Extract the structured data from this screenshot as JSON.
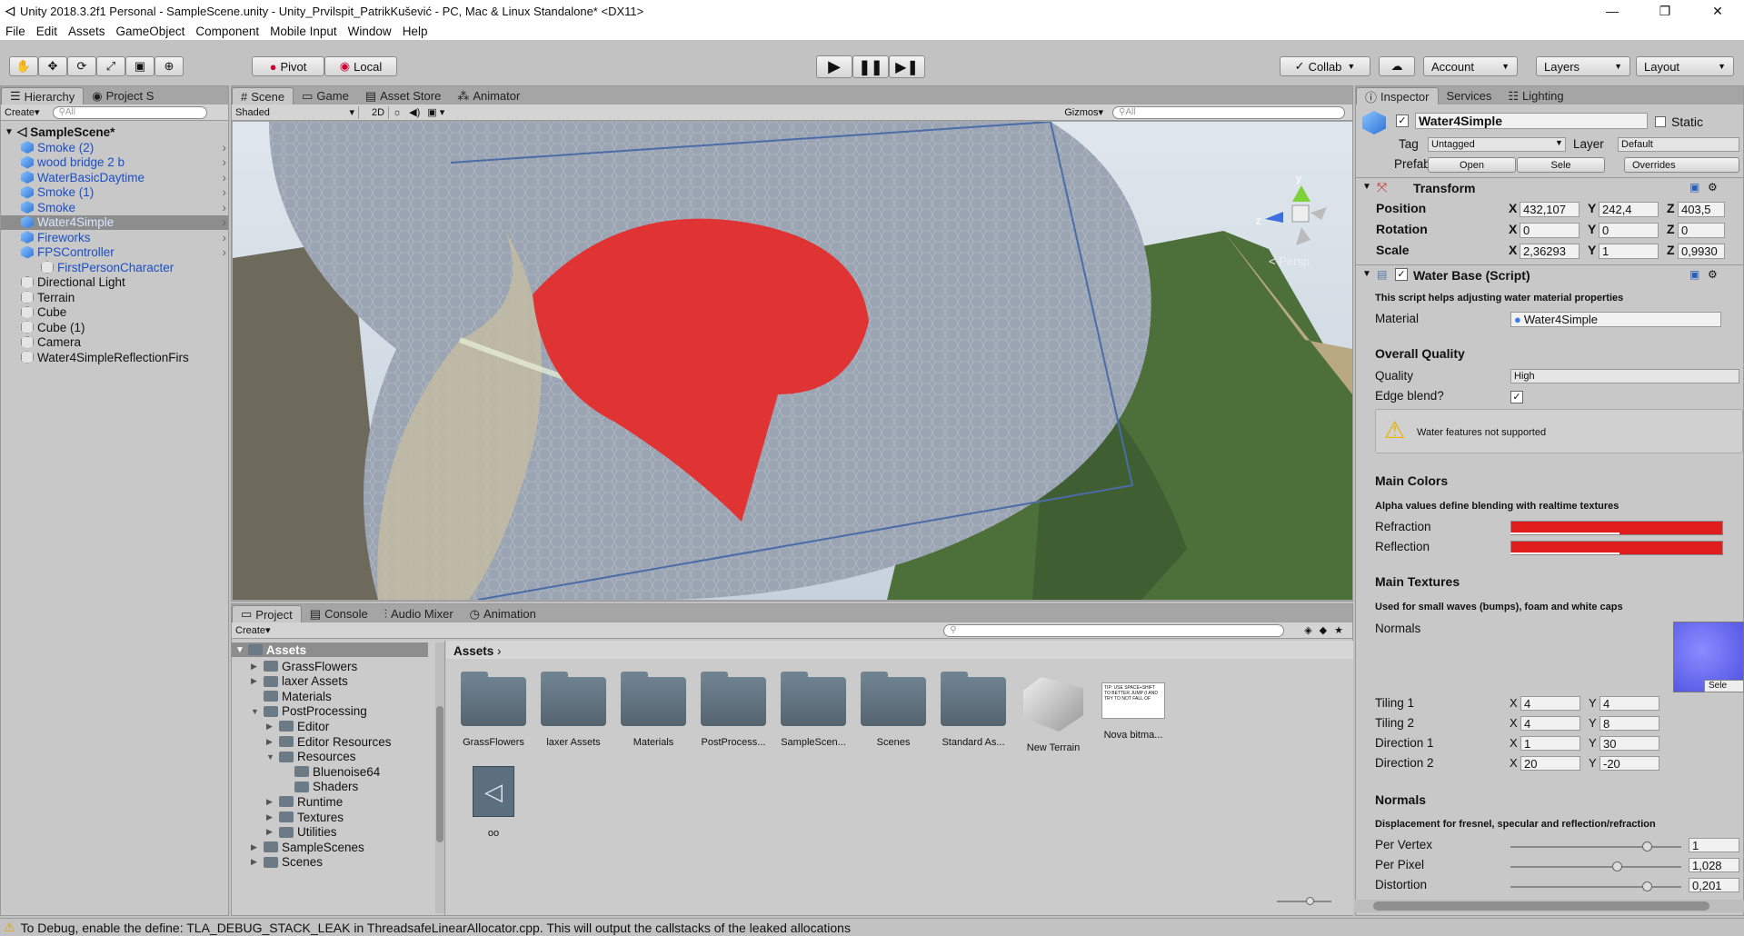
{
  "window": {
    "title": "Unity 2018.3.2f1 Personal - SampleScene.unity - Unity_Prvilspit_PatrikKušević - PC, Mac & Linux Standalone* <DX11>"
  },
  "menu": [
    "File",
    "Edit",
    "Assets",
    "GameObject",
    "Component",
    "Mobile Input",
    "Window",
    "Help"
  ],
  "toolbar": {
    "pivot": "Pivot",
    "local": "Local",
    "collab": "Collab",
    "account": "Account",
    "layers": "Layers",
    "layout": "Layout"
  },
  "hierarchy": {
    "tab": "Hierarchy",
    "project_tab": "Project S",
    "create": "Create",
    "search_placeholder": "All",
    "scene": "SampleScene*",
    "items": [
      {
        "label": "Smoke (2)",
        "type": "prefab"
      },
      {
        "label": "wood bridge 2 b",
        "type": "prefab"
      },
      {
        "label": "WaterBasicDaytime",
        "type": "prefab"
      },
      {
        "label": "Smoke (1)",
        "type": "prefab"
      },
      {
        "label": "Smoke",
        "type": "prefab"
      },
      {
        "label": "Water4Simple",
        "type": "prefab"
      },
      {
        "label": "Fireworks",
        "type": "prefab"
      },
      {
        "label": "FPSController",
        "type": "prefab"
      },
      {
        "label": "FirstPersonCharacter",
        "type": "child"
      },
      {
        "label": "Directional Light",
        "type": "object"
      },
      {
        "label": "Terrain",
        "type": "object"
      },
      {
        "label": "Cube",
        "type": "object"
      },
      {
        "label": "Cube (1)",
        "type": "object"
      },
      {
        "label": "Camera",
        "type": "object"
      },
      {
        "label": "Water4SimpleReflectionFirs",
        "type": "object"
      }
    ]
  },
  "scene_view": {
    "tabs": [
      "Scene",
      "Game",
      "Asset Store",
      "Animator"
    ],
    "shading": "Shaded",
    "mode_2d": "2D",
    "gizmos": "Gizmos",
    "search_placeholder": "All",
    "persp": "< Persp",
    "axis_y": "y",
    "axis_z": "z"
  },
  "project": {
    "tabs": [
      "Project",
      "Console",
      "Audio Mixer",
      "Animation"
    ],
    "create": "Create",
    "root": "Assets",
    "tree": [
      {
        "label": "GrassFlowers",
        "depth": 1
      },
      {
        "label": "laxer Assets",
        "depth": 1
      },
      {
        "label": "Materials",
        "depth": 1
      },
      {
        "label": "PostProcessing",
        "depth": 1
      },
      {
        "label": "Editor",
        "depth": 2
      },
      {
        "label": "Editor Resources",
        "depth": 2
      },
      {
        "label": "Resources",
        "depth": 2
      },
      {
        "label": "Bluenoise64",
        "depth": 3
      },
      {
        "label": "Shaders",
        "depth": 3
      },
      {
        "label": "Runtime",
        "depth": 2
      },
      {
        "label": "Textures",
        "depth": 2
      },
      {
        "label": "Utilities",
        "depth": 2
      },
      {
        "label": "SampleScenes",
        "depth": 1
      },
      {
        "label": "Scenes",
        "depth": 1
      }
    ],
    "breadcrumb": "Assets",
    "assets": [
      "GrassFlowers",
      "laxer Assets",
      "Materials",
      "PostProcess...",
      "SampleScen...",
      "Scenes",
      "Standard As...",
      "New Terrain",
      "Nova bitma...",
      "oo"
    ],
    "note_text": "TIP: USE SPACE+SHIFT TO BETTER JUMP (I AND TRY TO NOT FALL OF"
  },
  "inspector": {
    "tabs": [
      "Inspector",
      "Services",
      "Lighting"
    ],
    "name": "Water4Simple",
    "static": "Static",
    "tag_label": "Tag",
    "tag": "Untagged",
    "layer_label": "Layer",
    "layer": "Default",
    "prefab_label": "Prefab",
    "open": "Open",
    "select": "Sele",
    "overrides": "Overrides",
    "transform": {
      "title": "Transform",
      "position": "Position",
      "rotation": "Rotation",
      "scale": "Scale",
      "pos": [
        "432,107",
        "242,4",
        "403,5"
      ],
      "rot": [
        "0",
        "0",
        "0"
      ],
      "scl": [
        "2,36293",
        "1",
        "0,9930"
      ]
    },
    "water_base": {
      "title": "Water Base (Script)",
      "desc": "This script helps adjusting water material properties",
      "material_label": "Material",
      "material": "Water4Simple"
    },
    "overall_quality": "Overall Quality",
    "quality_label": "Quality",
    "quality": "High",
    "edge_blend": "Edge blend?",
    "warning": "Water features not supported",
    "main_colors": "Main Colors",
    "colors_desc": "Alpha values define blending with realtime textures",
    "refraction": "Refraction",
    "reflection": "Reflection",
    "main_textures": "Main Textures",
    "textures_desc": "Used for small waves (bumps), foam and white caps",
    "normals_label": "Normals",
    "tiling1": "Tiling 1",
    "tiling2": "Tiling 2",
    "direction1": "Direction 1",
    "direction2": "Direction 2",
    "t1": [
      "4",
      "4"
    ],
    "t2": [
      "4",
      "8"
    ],
    "d1": [
      "1",
      "30"
    ],
    "d2": [
      "20",
      "-20"
    ],
    "normals_section": "Normals",
    "normals_desc": "Displacement for fresnel, specular and reflection/refraction",
    "per_vertex": "Per Vertex",
    "per_pixel": "Per Pixel",
    "distortion": "Distortion",
    "pv": "1",
    "pp": "1,028",
    "dist": "0,201",
    "pv_level": 0.8,
    "pp_level": 0.62,
    "dist_level": 0.8
  },
  "axis_labels": {
    "x": "X",
    "y": "Y",
    "z": "Z"
  },
  "status": "To Debug, enable the define: TLA_DEBUG_STACK_LEAK in ThreadsafeLinearAllocator.cpp. This will output the callstacks of the leaked allocations",
  "colors": {
    "selection": "#3e7de0",
    "accent_red": "#e01c1c",
    "scene_bg": "#d2dbe5"
  }
}
